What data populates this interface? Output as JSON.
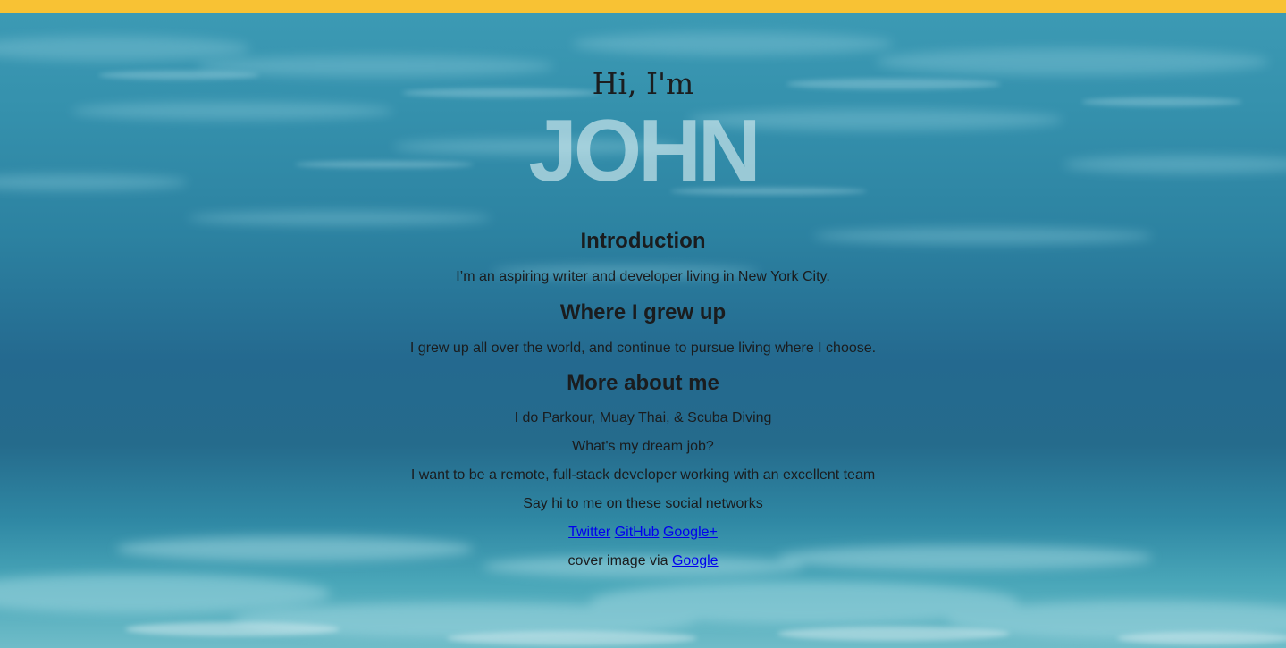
{
  "hero": {
    "greeting": "Hi, I'm",
    "name": "JOHN"
  },
  "sections": {
    "introduction": {
      "heading": "Introduction",
      "text": "I’m an aspiring writer and developer living in New York City."
    },
    "grew_up": {
      "heading": "Where I grew up",
      "text": "I grew up all over the world, and continue to pursue living where I choose."
    },
    "more": {
      "heading": "More about me",
      "hobbies": "I do Parkour, Muay Thai, & Scuba Diving",
      "dream_question": "What's my dream job?",
      "dream_answer": "I want to be a remote, full-stack developer working with an excellent team",
      "social_prompt": "Say hi to me on these social networks"
    }
  },
  "social_links": {
    "twitter": "Twitter",
    "github": "GitHub",
    "googleplus": "Google+"
  },
  "credit": {
    "text": "cover image via",
    "link": "Google"
  },
  "colors": {
    "topbar": "#f8c234",
    "link": "#0000ee"
  }
}
